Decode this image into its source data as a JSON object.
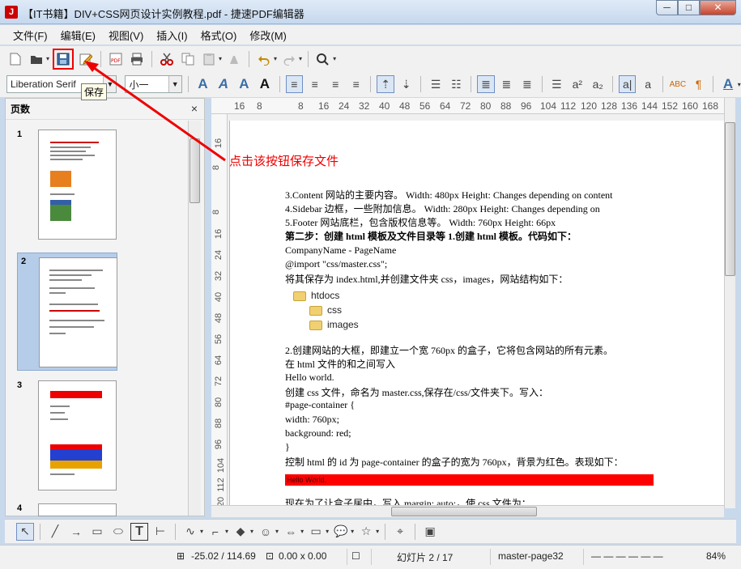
{
  "window": {
    "title": "【IT书籍】DIV+CSS网页设计实例教程.pdf - 捷速PDF编辑器",
    "minimize": "─",
    "maximize": "□",
    "close": "✕"
  },
  "menu": [
    {
      "label": "文件(F)"
    },
    {
      "label": "编辑(E)"
    },
    {
      "label": "视图(V)"
    },
    {
      "label": "插入(I)"
    },
    {
      "label": "格式(O)"
    },
    {
      "label": "修改(M)"
    }
  ],
  "toolbar": {
    "save_tooltip": "保存",
    "font_name": "Liberation Serif",
    "font_size": "小一"
  },
  "annotation": {
    "text": "点击该按钮保存文件"
  },
  "slides_panel": {
    "title": "页数",
    "close": "×",
    "slides": [
      {
        "number": "1"
      },
      {
        "number": "2"
      },
      {
        "number": "3"
      },
      {
        "number": "4"
      }
    ]
  },
  "ruler": {
    "h": [
      "16",
      "8",
      "8",
      "16",
      "24",
      "32",
      "40",
      "48",
      "56",
      "64",
      "72",
      "80",
      "88",
      "96",
      "104",
      "112",
      "120",
      "128",
      "136",
      "144",
      "152",
      "160",
      "168"
    ],
    "v": [
      "16",
      "8",
      "8",
      "16",
      "24",
      "32",
      "40",
      "48",
      "56",
      "64",
      "72",
      "80",
      "88",
      "96",
      "104",
      "112",
      "120"
    ]
  },
  "document": {
    "lines": [
      "3.Content 网站的主要内容。  Width: 480px Height: Changes depending on content",
      "4.Sidebar 边框，一些附加信息。  Width: 280px Height: Changes depending on",
      "5.Footer 网站底栏，包含版权信息等。  Width: 760px Height: 66px",
      "第二步：创建 html 模板及文件目录等  1.创建 html 模板。代码如下：",
      "CompanyName - PageName",
      "@import \"css/master.css\";",
      "将其保存为 index.html,并创建文件夹 css，images，网站结构如下：",
      "2.创建网站的大框，即建立一个宽 760px 的盒子，它将包含网站的所有元素。",
      "在 html 文件的和之间写入",
      "Hello world.",
      "创建 css 文件，命名为 master.css,保存在/css/文件夹下。写入：",
      "#page-container {",
      "width: 760px;",
      "background: red;",
      "}",
      "控制 html 的 id 为 page-container 的盒子的宽为 760px，背景为红色。表现如下：",
      "现在为了让盒子居中，写入 margin: auto;，使 css 文件为："
    ],
    "tree": [
      "htdocs",
      "css",
      "images"
    ],
    "red_bar_text": "Hello World."
  },
  "status": {
    "position": "-25.02 / 114.69",
    "size": "0.00 x 0.00",
    "slide": "幻灯片 2 / 17",
    "master": "master-page32",
    "zoom": "84%"
  },
  "colors": {
    "highlight": "#e00000",
    "titlebar": "#c6d8ee",
    "selection": "#b6cde9"
  }
}
